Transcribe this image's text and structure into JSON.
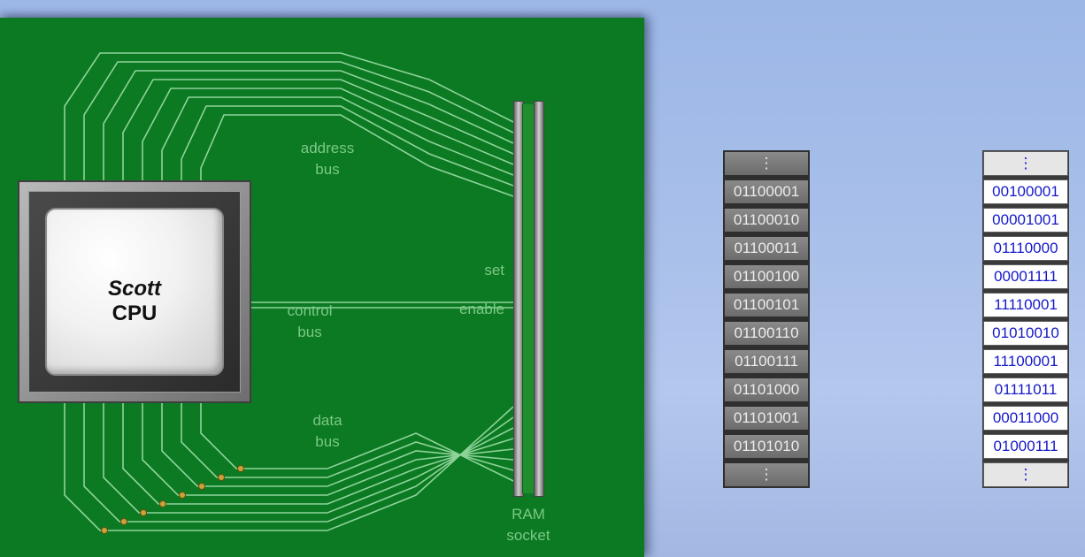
{
  "board": {
    "cpu_name": "Scott",
    "cpu_label": "CPU",
    "address_bus": [
      "address",
      "bus"
    ],
    "control_bus": [
      "control",
      "bus"
    ],
    "data_bus": [
      "data",
      "bus"
    ],
    "set_label": "set",
    "enable_label": "enable",
    "ram_socket": [
      "RAM",
      "socket"
    ]
  },
  "colors": {
    "board": "#0b7a22",
    "trace": "#8fd39a",
    "label": "#7cc887",
    "data_text": "#1418c8"
  },
  "addresses": [
    "⋮",
    "01100001",
    "01100010",
    "01100011",
    "01100100",
    "01100101",
    "01100110",
    "01100111",
    "01101000",
    "01101001",
    "01101010",
    "⋮"
  ],
  "values": [
    "⋮",
    "00100001",
    "00001001",
    "01110000",
    "00001111",
    "11110001",
    "01010010",
    "11100001",
    "01111011",
    "00011000",
    "01000111",
    "⋮"
  ]
}
